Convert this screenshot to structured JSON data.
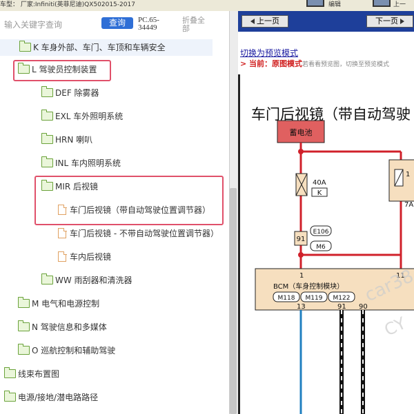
{
  "window": {
    "title_fragment": "车型：  厂家:Infiniti(英菲尼迪)QX502015-2017",
    "top_button_1": "编辑",
    "top_button_2": "上一"
  },
  "search": {
    "placeholder": "输入关键字查询",
    "button": "查询",
    "pc_label": "PC.65-34449",
    "collapse_all": "折叠全部"
  },
  "tree": {
    "k": "K 车身外部、车门、车顶和车辆安全",
    "l": "L 驾驶员控制装置",
    "def": "DEF 除雾器",
    "exl": "EXL 车外照明系统",
    "hrn": "HRN 喇叭",
    "inl": "INL 车内照明系统",
    "mir": "MIR 后视镜",
    "mir_1": "车门后视镜（带自动驾驶位置调节器）",
    "mir_2": "车门后视镜 - 不带自动驾驶位置调节器）",
    "mir_3": "车内后视镜",
    "ww": "WW 雨刮器和清洗器",
    "m": "M 电气和电源控制",
    "n": "N 驾驶信息和多媒体",
    "o": "O 巡航控制和辅助驾驶",
    "harness": "线束布置图",
    "power": "电源/接地/潜电路路径"
  },
  "viewer": {
    "prev": "上一页",
    "next": "下一页",
    "switch_link": "切换为预览模式",
    "current_prefix": "> 当前：",
    "current_mode": "原图模式",
    "current_hint": "若看看预览图，切换至预览模式"
  },
  "diagram": {
    "title": "车门后视镜（带自动驾驶",
    "battery": "蓄电池",
    "fuse_40a": "40A",
    "fuse_k": "K",
    "fuse_7a": "7A",
    "fuse_1": "1",
    "conn_91": "91",
    "e106": "E106",
    "m6": "M6",
    "pin_1": "1",
    "pin_11": "11",
    "bcm": "BCM（车身控制模块）",
    "m118": "M118",
    "m119": "M119",
    "m122": "M122",
    "pin_13": "13",
    "pin_91": "91",
    "pin_90": "90",
    "watermark": "car38",
    "watermark2": "CY"
  },
  "colors": {
    "accent": "#2f6fd6",
    "nav_bar": "#1e3f9a",
    "highlight_box": "#e0506a",
    "wire_red": "#d0202a",
    "folder_green": "#6aa23a"
  }
}
